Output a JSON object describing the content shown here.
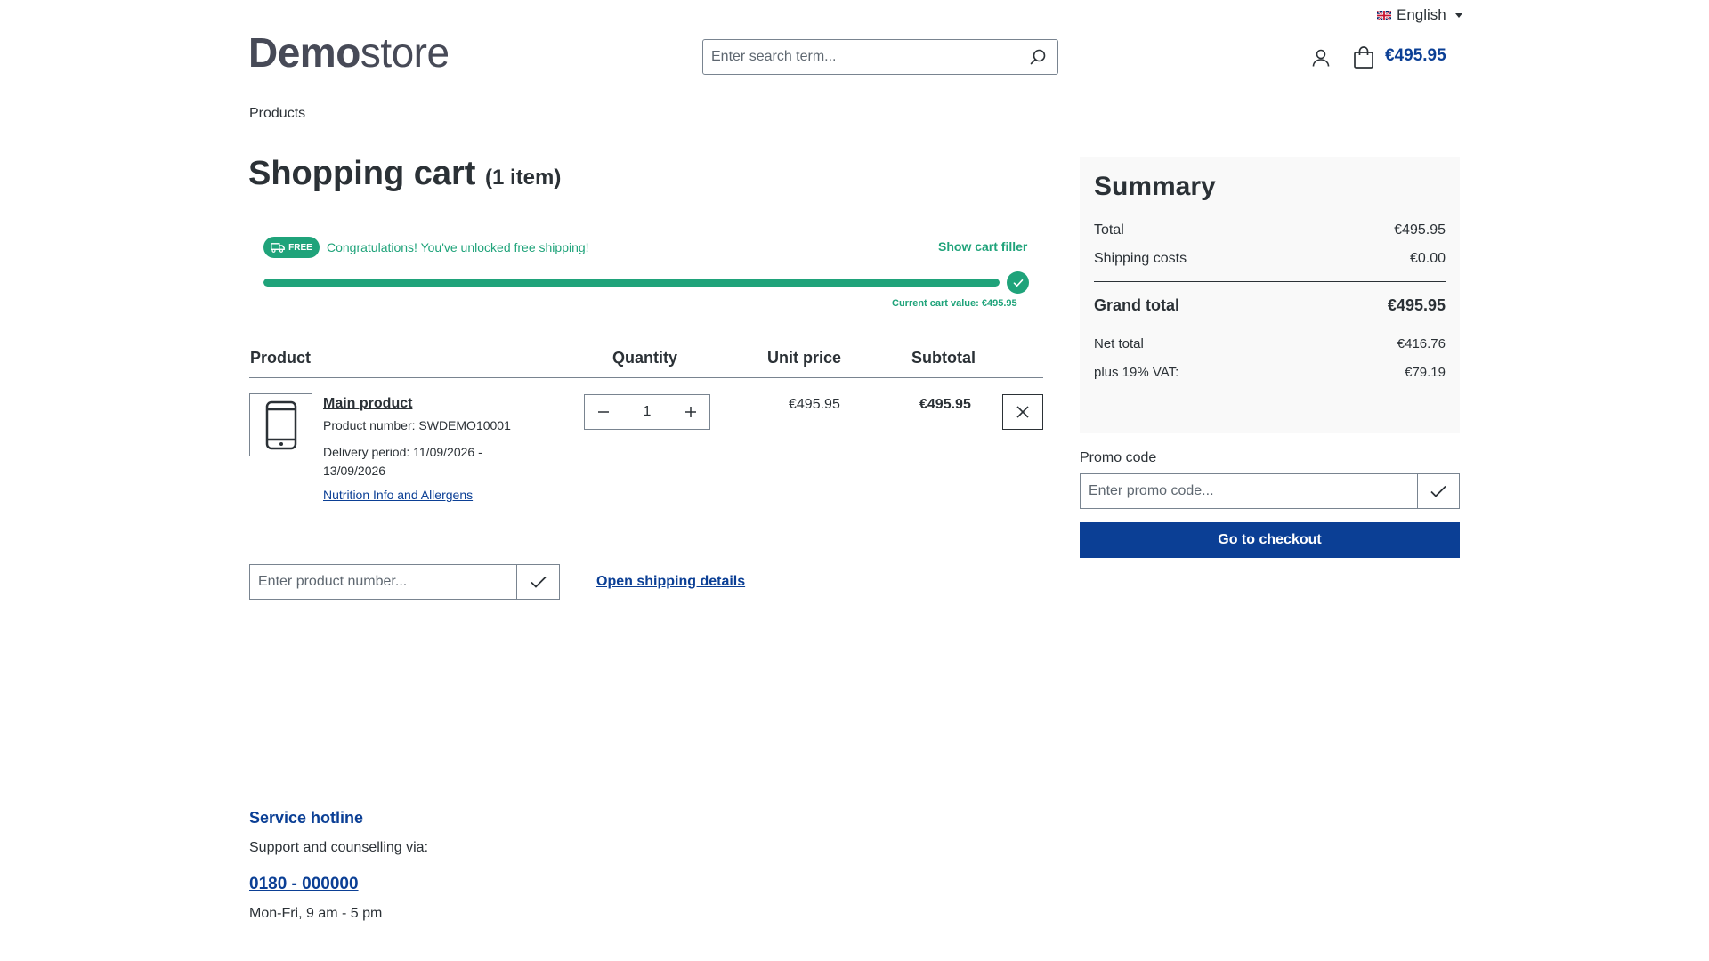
{
  "header": {
    "language": "English",
    "logo": {
      "bold": "Demo",
      "light": "store"
    },
    "search_placeholder": "Enter search term...",
    "cart_total": "€495.95"
  },
  "breadcrumb": "Products",
  "cart": {
    "title": "Shopping cart",
    "count_label": "(1 item)",
    "shipping": {
      "badge": "FREE",
      "message": "Congratulations! You've unlocked free shipping!",
      "show_filler": "Show cart filler",
      "progress_percent": 100,
      "current_value": "Current cart value: €495.95"
    },
    "columns": {
      "product": "Product",
      "quantity": "Quantity",
      "unit_price": "Unit price",
      "subtotal": "Subtotal"
    },
    "item": {
      "name": "Main product",
      "number": "Product number: SWDEMO10001",
      "delivery": "Delivery period: 11/09/2026 - 13/09/2026",
      "nutrition_link": "Nutrition Info and Allergens",
      "quantity": "1",
      "unit_price": "€495.95",
      "subtotal": "€495.95"
    },
    "add_product_placeholder": "Enter product number...",
    "shipping_details_link": "Open shipping details"
  },
  "summary": {
    "title": "Summary",
    "total_label": "Total",
    "total_value": "€495.95",
    "shipping_label": "Shipping costs",
    "shipping_value": "€0.00",
    "grand_label": "Grand total",
    "grand_value": "€495.95",
    "net_label": "Net total",
    "net_value": "€416.76",
    "vat_label": "plus 19% VAT:",
    "vat_value": "€79.19",
    "promo_label": "Promo code",
    "promo_placeholder": "Enter promo code...",
    "checkout_label": "Go to checkout"
  },
  "footer": {
    "hotline_title": "Service hotline",
    "hotline_sub": "Support and counselling via:",
    "phone": "0180 - 000000",
    "hours": "Mon-Fri, 9 am - 5 pm"
  },
  "colors": {
    "primary": "#0b3f95",
    "success": "#1fa37a",
    "text": "#2b3136"
  }
}
